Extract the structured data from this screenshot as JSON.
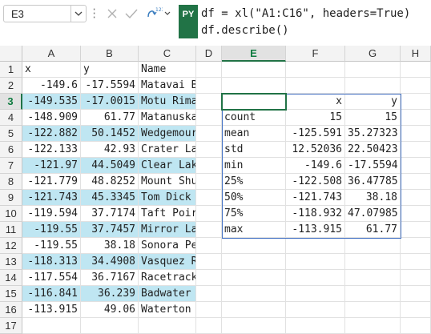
{
  "namebox": {
    "value": "E3"
  },
  "formula": {
    "badge": "PY",
    "line1": "df = xl(\"A1:C16\", headers=True)",
    "line2": "df.describe()"
  },
  "columns": [
    "A",
    "B",
    "C",
    "D",
    "E",
    "F",
    "G",
    "H"
  ],
  "rows": [
    "1",
    "2",
    "3",
    "4",
    "5",
    "6",
    "7",
    "8",
    "9",
    "10",
    "11",
    "12",
    "13",
    "14",
    "15",
    "16",
    "17"
  ],
  "table": {
    "headers": [
      "x",
      "y",
      "Name"
    ],
    "rows": [
      [
        "-149.6",
        "-17.5594",
        "Matavai B"
      ],
      [
        "-149.535",
        "-17.0015",
        "Motu Rima"
      ],
      [
        "-148.909",
        "61.77",
        "Matanuska"
      ],
      [
        "-122.882",
        "50.1452",
        "Wedgemour"
      ],
      [
        "-122.133",
        "42.93",
        "Crater La"
      ],
      [
        "-121.97",
        "44.5049",
        "Clear Lak"
      ],
      [
        "-121.779",
        "48.8252",
        "Mount Shu"
      ],
      [
        "-121.743",
        "45.3345",
        "Tom Dick"
      ],
      [
        "-119.594",
        "37.7174",
        "Taft Poir"
      ],
      [
        "-119.55",
        "37.7457",
        "Mirror La"
      ],
      [
        "-119.55",
        "38.18",
        "Sonora Pe"
      ],
      [
        "-118.313",
        "34.4908",
        "Vasquez R"
      ],
      [
        "-117.554",
        "36.7167",
        "Racetrack"
      ],
      [
        "-116.841",
        "36.239",
        "Badwater"
      ],
      [
        "-113.915",
        "49.06",
        "Waterton"
      ]
    ]
  },
  "describe": {
    "headers": [
      "",
      "x",
      "y"
    ],
    "rows": [
      [
        "count",
        "15",
        "15"
      ],
      [
        "mean",
        "-125.591",
        "35.27323"
      ],
      [
        "std",
        "12.52036",
        "22.50423"
      ],
      [
        "min",
        "-149.6",
        "-17.5594"
      ],
      [
        "25%",
        "-122.508",
        "36.47785"
      ],
      [
        "50%",
        "-121.743",
        "38.18"
      ],
      [
        "75%",
        "-118.932",
        "47.07985"
      ],
      [
        "max",
        "-113.915",
        "61.77"
      ]
    ]
  },
  "colors": {
    "accent": "#217346",
    "band": "#bfe6f2",
    "spill": "#4472c4"
  }
}
